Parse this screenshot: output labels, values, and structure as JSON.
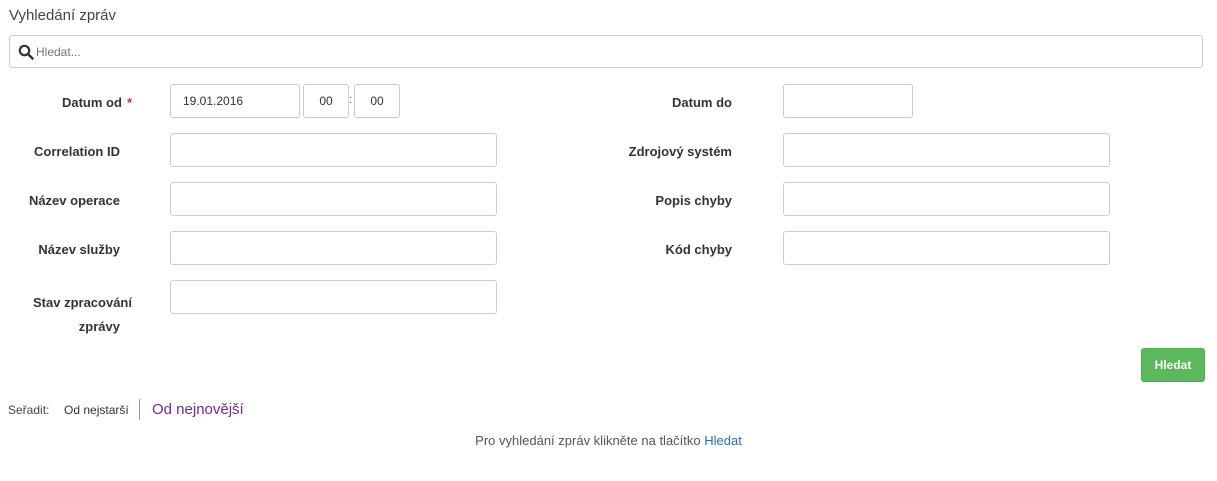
{
  "page": {
    "title": "Vyhledání zpráv"
  },
  "search": {
    "placeholder": "Hledat...",
    "value": ""
  },
  "form": {
    "date_from": {
      "label": "Datum od",
      "required_mark": "*",
      "date_value": "19.01.2016",
      "hour_value": "00",
      "minute_value": "00",
      "separator": ":"
    },
    "date_to": {
      "label": "Datum do",
      "value": ""
    },
    "correlation_id": {
      "label": "Correlation ID",
      "value": ""
    },
    "source_system": {
      "label": "Zdrojový systém",
      "value": ""
    },
    "operation_name": {
      "label": "Název operace",
      "value": ""
    },
    "error_description": {
      "label": "Popis chyby",
      "value": ""
    },
    "service_name": {
      "label": "Název služby",
      "value": ""
    },
    "error_code": {
      "label": "Kód chyby",
      "value": ""
    },
    "processing_state": {
      "label_line1": "Stav zpracování",
      "label_line2": "zprávy",
      "value": ""
    }
  },
  "actions": {
    "search_button": "Hledat"
  },
  "sort": {
    "label": "Seřadit:",
    "oldest": "Od nejstarší",
    "newest": "Od nejnovější"
  },
  "hint": {
    "text": "Pro vyhledání zpráv klikněte na tlačítko",
    "link": "Hledat"
  },
  "colors": {
    "primary_button": "#5cb85c",
    "sort_active": "#6f2c91",
    "link": "#2a6ebb",
    "required": "#c0392b"
  },
  "icons": {
    "search": "search-icon"
  }
}
